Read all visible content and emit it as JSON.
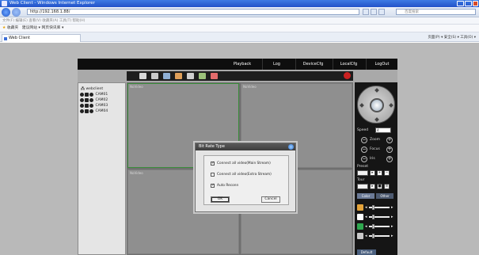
{
  "ie": {
    "title": "Web Client - Windows Internet Explorer",
    "address": "http://192.168.1.88/",
    "search_placeholder": "百度搜索",
    "menu_text": "文件(F)  编辑(E)  查看(V)  收藏夹(A)  工具(T)  帮助(H)",
    "favorites_label": "收藏夹",
    "fav_links": "建议网站 ▾   网页快讯库 ▾",
    "tab_title": "Web Client",
    "command_bar": "页面(P) ▾  安全(S) ▾  工具(O) ▾"
  },
  "nav": {
    "items": [
      "Playback",
      "Log",
      "DeviceCfg",
      "LocalCfg",
      "LogOut"
    ]
  },
  "cameras": {
    "root": "webclient",
    "items": [
      "CAM01",
      "CAM02",
      "CAM03",
      "CAM04"
    ]
  },
  "grid": {
    "cells": [
      "NoVideo",
      "NoVideo",
      "NoVideo",
      "NoVideo"
    ]
  },
  "ptz": {
    "speed_label": "Speed",
    "speed_value": "4",
    "zoom_label": "Zoom",
    "focus_label": "Focus",
    "iris_label": "Iris",
    "preset_label": "Preset",
    "tour_label": "Tour",
    "tab1": "Color",
    "tab2": "Other",
    "default_label": "Default",
    "swatch_colors": [
      "#e3a33a",
      "#ffffff",
      "#2fa84f",
      "#c9c9c9"
    ]
  },
  "dialog": {
    "title": "Bit Rate Type",
    "options": [
      {
        "label": "Connect all video(Main Stream)",
        "checked": true
      },
      {
        "label": "Connect all video(Extra Stream)",
        "checked": false
      },
      {
        "label": "Auto Reconn",
        "checked": true
      }
    ],
    "ok_label": "OK",
    "cancel_label": "Cancel"
  },
  "colors": {
    "toolbar_icons": [
      "#d8d8d8",
      "#c9c9c9",
      "#8fb0d6",
      "#e0a05a",
      "#cfcfcf",
      "#9cc27a",
      "#e26b6b"
    ]
  }
}
